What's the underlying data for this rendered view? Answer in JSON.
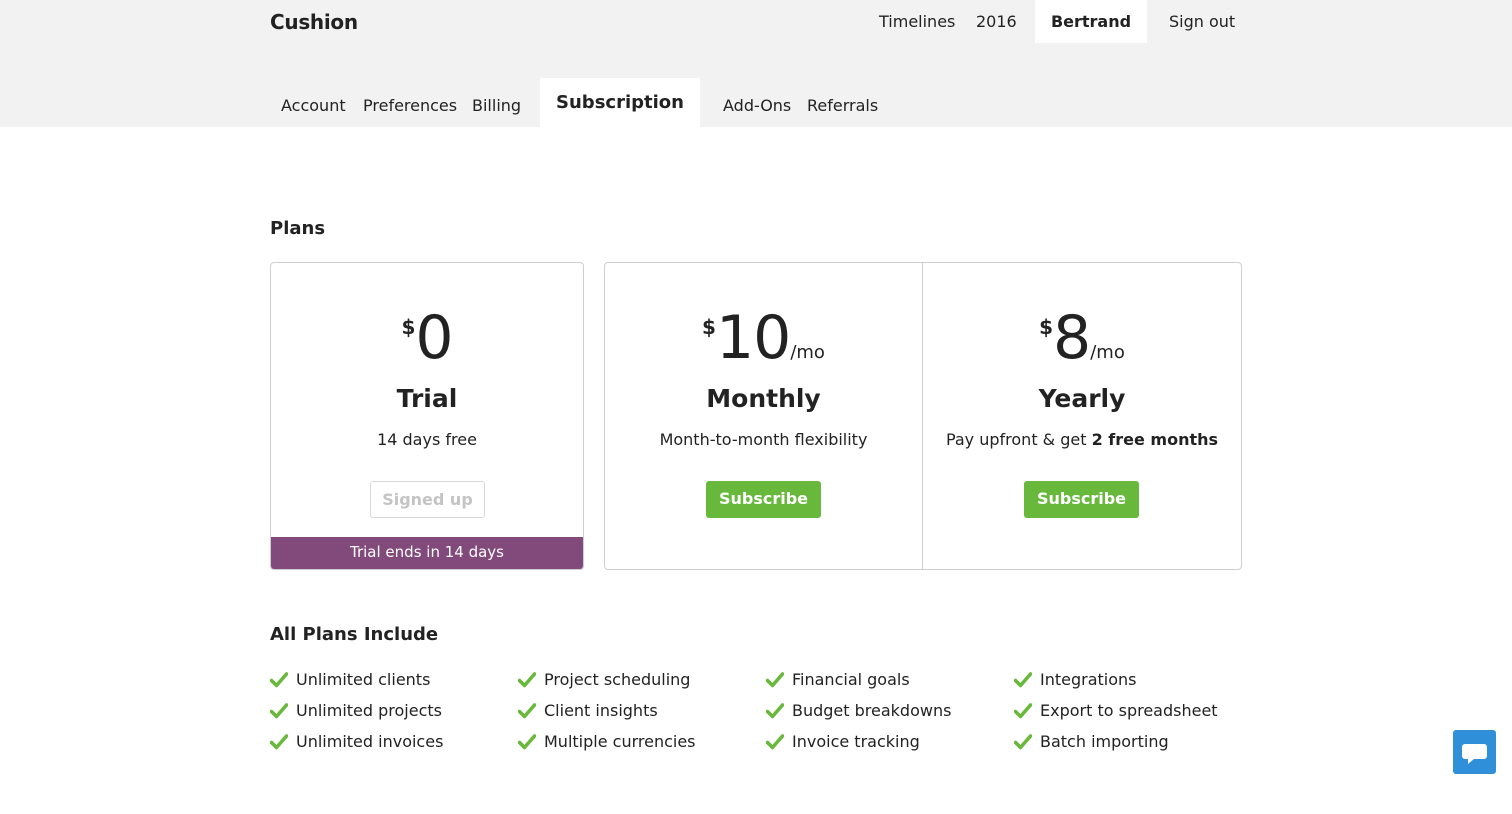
{
  "app": {
    "name": "Cushion"
  },
  "topnav": {
    "timelines": "Timelines",
    "year": "2016",
    "user": "Bertrand",
    "signout": "Sign out"
  },
  "tabs": [
    "Account",
    "Preferences",
    "Billing",
    "Subscription",
    "Add-Ons",
    "Referrals"
  ],
  "active_tab": "Subscription",
  "plans_title": "Plans",
  "plans": [
    {
      "currency": "$",
      "amount": "0",
      "period": "",
      "name": "Trial",
      "desc": "14 days free",
      "button": "Signed up",
      "banner": "Trial ends in 14 days"
    },
    {
      "currency": "$",
      "amount": "10",
      "period": "/mo",
      "name": "Monthly",
      "desc": "Month-to-month flexibility",
      "button": "Subscribe"
    },
    {
      "currency": "$",
      "amount": "8",
      "period": "/mo",
      "name": "Yearly",
      "desc_prefix": "Pay upfront & get ",
      "desc_bold": "2 free months",
      "button": "Subscribe"
    }
  ],
  "features_title": "All Plans Include",
  "features": [
    [
      "Unlimited clients",
      "Unlimited projects",
      "Unlimited invoices"
    ],
    [
      "Project scheduling",
      "Client insights",
      "Multiple currencies"
    ],
    [
      "Financial goals",
      "Budget breakdowns",
      "Invoice tracking"
    ],
    [
      "Integrations",
      "Export to spreadsheet",
      "Batch importing"
    ]
  ],
  "icons": {
    "check": "check-icon",
    "chat": "chat-bubble-icon"
  },
  "colors": {
    "accent_green": "#68b83c",
    "trial_purple": "#824a7b",
    "chat_blue": "#2f8fd8",
    "header_bg": "#f2f2f2"
  }
}
